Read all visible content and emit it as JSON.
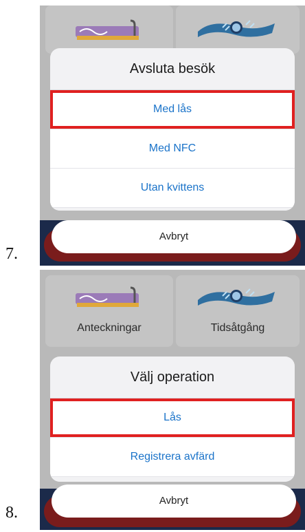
{
  "steps": [
    {
      "number": "7.",
      "sheet_title": "Avsluta besök",
      "options": [
        "Med lås",
        "Med NFC",
        "Utan kvittens"
      ],
      "highlighted_option": "Med lås",
      "cancel_label": "Avbryt",
      "tiles": {
        "left_icon": "pen-icon",
        "right_icon": "clock-hands-icon"
      }
    },
    {
      "number": "8.",
      "sheet_title": "Välj operation",
      "options": [
        "Lås",
        "Registrera avfärd"
      ],
      "highlighted_option": "Lås",
      "cancel_label": "Avbryt",
      "tiles": {
        "left_label": "Anteckningar",
        "right_label": "Tidsåtgång",
        "left_icon": "pen-icon",
        "right_icon": "clock-hands-icon"
      }
    }
  ],
  "colors": {
    "highlight": "#e02020",
    "option_text": "#1a73c9",
    "bottom_bar": "#1b2a4a",
    "overlay": "#b9b9b9"
  }
}
